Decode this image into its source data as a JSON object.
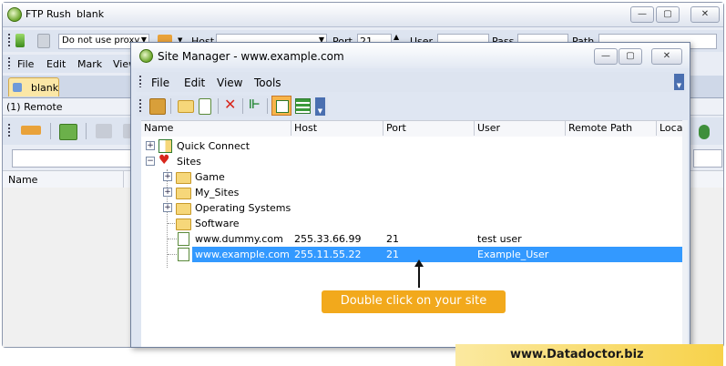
{
  "main_window": {
    "app_name": "FTP Rush",
    "doc_name": "blank",
    "proxy_value": "Do not use proxy",
    "fields": {
      "host_label": "Host",
      "port_label": "Port",
      "port_value": "21",
      "user_label": "User",
      "pass_label": "Pass",
      "path_label": "Path"
    },
    "menu": [
      "File",
      "Edit",
      "Mark",
      "View"
    ],
    "tab_label": "blank",
    "remote_label": "(1) Remote",
    "name_column": "Name"
  },
  "site_manager": {
    "title": "Site Manager  - www.example.com",
    "menu": [
      "File",
      "Edit",
      "View",
      "Tools"
    ],
    "columns": [
      "Name",
      "Host",
      "Port",
      "User",
      "Remote Path",
      "Local"
    ],
    "tree": {
      "quick_connect": "Quick Connect",
      "sites": "Sites",
      "folders": [
        "Game",
        "My_Sites",
        "Operating Systems",
        "Software"
      ],
      "site_rows": [
        {
          "name": "www.dummy.com",
          "host": "255.33.66.99",
          "port": "21",
          "user": "test user",
          "selected": false
        },
        {
          "name": "www.example.com",
          "host": "255.11.55.22",
          "port": "21",
          "user": "Example_User",
          "selected": true
        }
      ]
    }
  },
  "callout": {
    "text": "Double click on your site"
  },
  "footer": {
    "brand_text": "www.Datadoctor.biz"
  },
  "colors": {
    "selection": "#3399ff",
    "callout_bg": "#f2a91c",
    "toolbar_bg": "#d9e1ee",
    "active_toggle": "#f7b54a"
  }
}
